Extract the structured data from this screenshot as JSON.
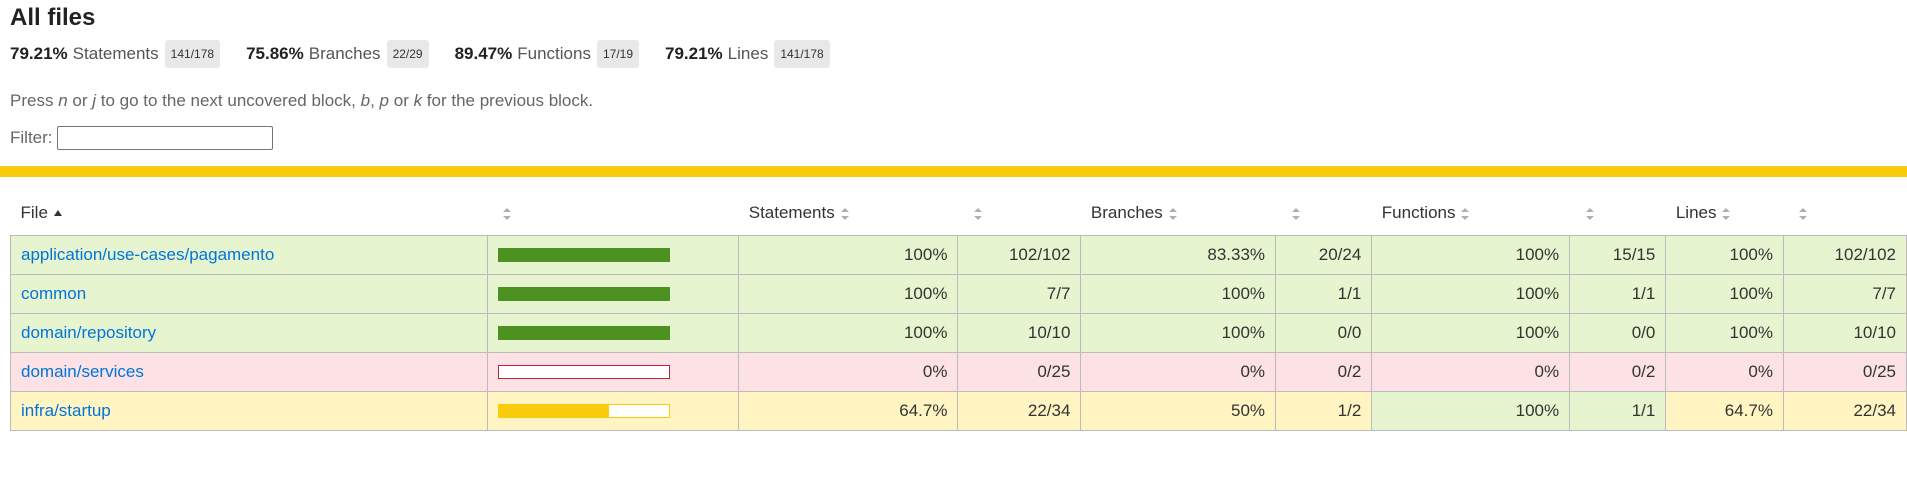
{
  "page": {
    "title": "All files",
    "hint": {
      "prefix": "Press ",
      "key_n": "n",
      "or1": " or ",
      "key_j": "j",
      "mid": " to go to the next uncovered block, ",
      "key_b": "b",
      "comma": ", ",
      "key_p": "p",
      "or2": " or ",
      "key_k": "k",
      "suffix": " for the previous block."
    },
    "filter_label": "Filter:",
    "filter_value": ""
  },
  "summary": [
    {
      "pct": "79.21%",
      "label": "Statements",
      "fraction": "141/178"
    },
    {
      "pct": "75.86%",
      "label": "Branches",
      "fraction": "22/29"
    },
    {
      "pct": "89.47%",
      "label": "Functions",
      "fraction": "17/19"
    },
    {
      "pct": "79.21%",
      "label": "Lines",
      "fraction": "141/178"
    }
  ],
  "table": {
    "headers": {
      "file": "File",
      "statements": "Statements",
      "branches": "Branches",
      "functions": "Functions",
      "lines": "Lines"
    },
    "rows": [
      {
        "file": "application/use-cases/pagamento",
        "level": "high",
        "bar_pct": 1.0,
        "stmt_pct": "100%",
        "stmt_frac": "102/102",
        "br_pct": "83.33%",
        "br_frac": "20/24",
        "fn_pct": "100%",
        "fn_frac": "15/15",
        "ln_pct": "100%",
        "ln_frac": "102/102"
      },
      {
        "file": "common",
        "level": "high",
        "bar_pct": 1.0,
        "stmt_pct": "100%",
        "stmt_frac": "7/7",
        "br_pct": "100%",
        "br_frac": "1/1",
        "fn_pct": "100%",
        "fn_frac": "1/1",
        "ln_pct": "100%",
        "ln_frac": "7/7"
      },
      {
        "file": "domain/repository",
        "level": "high",
        "bar_pct": 1.0,
        "stmt_pct": "100%",
        "stmt_frac": "10/10",
        "br_pct": "100%",
        "br_frac": "0/0",
        "fn_pct": "100%",
        "fn_frac": "0/0",
        "ln_pct": "100%",
        "ln_frac": "10/10"
      },
      {
        "file": "domain/services",
        "level": "low",
        "bar_pct": 0.0,
        "stmt_pct": "0%",
        "stmt_frac": "0/25",
        "br_pct": "0%",
        "br_frac": "0/2",
        "fn_pct": "0%",
        "fn_frac": "0/2",
        "ln_pct": "0%",
        "ln_frac": "0/25"
      },
      {
        "file": "infra/startup",
        "level": "medium",
        "bar_pct": 0.647,
        "stmt_pct": "64.7%",
        "stmt_frac": "22/34",
        "br_pct": "50%",
        "br_frac": "1/2",
        "fn_pct": "100%",
        "fn_frac": "1/1",
        "fn_level": "high",
        "ln_pct": "64.7%",
        "ln_frac": "22/34"
      }
    ]
  },
  "colors": {
    "high": "#e6f5d0",
    "medium": "#fff4c2",
    "low": "#fce1e5",
    "status_bar": "#f9cd0b",
    "link": "#0074d9"
  }
}
